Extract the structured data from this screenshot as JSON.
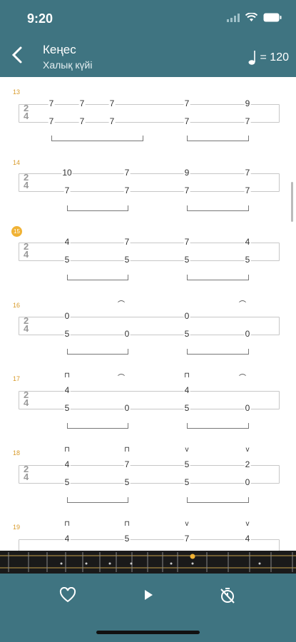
{
  "status": {
    "time": "9:20"
  },
  "header": {
    "title": "Кеңес",
    "subtitle": "Халық күйі",
    "tempo_value": "= 120"
  },
  "measures": [
    {
      "number": "13",
      "top": [
        "7",
        "7",
        "7",
        "7",
        "9"
      ],
      "bottom": [
        "7",
        "7",
        "7",
        "7",
        "7"
      ]
    },
    {
      "number": "14",
      "top": [
        "10",
        "7",
        "9",
        "7"
      ],
      "bottom": [
        "7",
        "7",
        "7",
        "7"
      ]
    },
    {
      "number": "15",
      "top": [
        "4",
        "7",
        "7",
        "4"
      ],
      "bottom": [
        "5",
        "5",
        "5",
        "5"
      ]
    },
    {
      "number": "16",
      "top": [
        "0",
        "0"
      ],
      "bottom": [
        "5",
        "0",
        "5",
        "0"
      ]
    },
    {
      "number": "17",
      "top": [
        "4",
        "4"
      ],
      "bottom": [
        "5",
        "0",
        "5",
        "0"
      ]
    },
    {
      "number": "18",
      "top": [
        "4",
        "7",
        "5",
        "2"
      ],
      "bottom": [
        "5",
        "5",
        "5",
        "0"
      ]
    },
    {
      "number": "19",
      "top": [
        "4",
        "5",
        "7",
        "4"
      ],
      "bottom": []
    }
  ],
  "time_signature": {
    "numerator": "2",
    "denominator": "4"
  },
  "player": {
    "favorite_icon": "heart-icon",
    "play_icon": "play-icon",
    "timer_icon": "timer-off-icon"
  },
  "colors": {
    "bar": "#3f7481",
    "accent": "#f0b234"
  }
}
